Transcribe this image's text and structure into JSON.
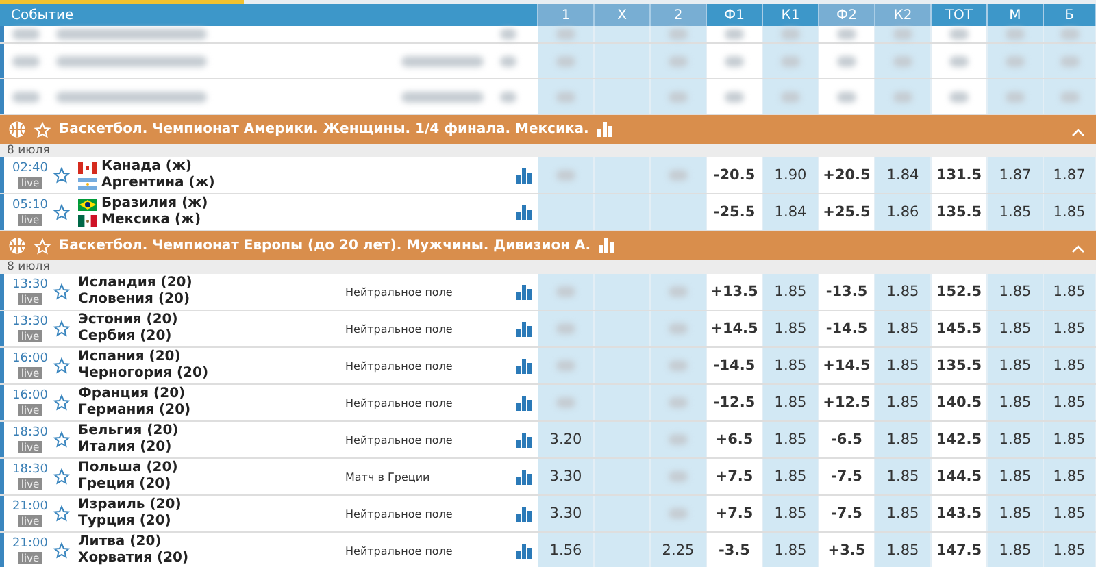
{
  "header": {
    "event_label": "Событие",
    "columns": [
      {
        "label": "1",
        "lit": false
      },
      {
        "label": "X",
        "lit": false
      },
      {
        "label": "2",
        "lit": false
      },
      {
        "label": "Ф1",
        "lit": true
      },
      {
        "label": "К1",
        "lit": true
      },
      {
        "label": "Ф2",
        "lit": false
      },
      {
        "label": "К2",
        "lit": false
      },
      {
        "label": "ТОТ",
        "lit": true
      },
      {
        "label": "М",
        "lit": true
      },
      {
        "label": "Б",
        "lit": true
      }
    ]
  },
  "blurred_rows": [
    {
      "kind": "partial"
    },
    {
      "kind": "full"
    },
    {
      "kind": "full"
    }
  ],
  "sections": [
    {
      "title": "Баскетбол. Чемпионат Америки. Женщины. 1/4 финала. Мексика.",
      "expanded": true,
      "date": "8 июля",
      "matches": [
        {
          "time": "02:40",
          "live": "live",
          "teams": [
            {
              "name": "Канада (ж)",
              "kind": "ca"
            },
            {
              "name": "Аргентина (ж)",
              "kind": "ar"
            }
          ],
          "odds": [
            {
              "kind": "blurred"
            },
            {
              "kind": "empty"
            },
            {
              "kind": "blurred"
            },
            {
              "kind": "value",
              "text": "-20.5"
            },
            {
              "kind": "value",
              "text": "1.90"
            },
            {
              "kind": "value",
              "text": "+20.5"
            },
            {
              "kind": "value",
              "text": "1.84"
            },
            {
              "kind": "value",
              "text": "131.5"
            },
            {
              "kind": "value",
              "text": "1.87"
            },
            {
              "kind": "value",
              "text": "1.87"
            }
          ]
        },
        {
          "time": "05:10",
          "live": "live",
          "teams": [
            {
              "name": "Бразилия (ж)",
              "kind": "br"
            },
            {
              "name": "Мексика (ж)",
              "kind": "mx"
            }
          ],
          "odds": [
            {
              "kind": "empty"
            },
            {
              "kind": "empty"
            },
            {
              "kind": "empty"
            },
            {
              "kind": "value",
              "text": "-25.5"
            },
            {
              "kind": "value",
              "text": "1.84"
            },
            {
              "kind": "value",
              "text": "+25.5"
            },
            {
              "kind": "value",
              "text": "1.86"
            },
            {
              "kind": "value",
              "text": "135.5"
            },
            {
              "kind": "value",
              "text": "1.85"
            },
            {
              "kind": "value",
              "text": "1.85"
            }
          ]
        }
      ]
    },
    {
      "title": "Баскетбол. Чемпионат Европы (до 20 лет). Мужчины. Дивизион А.",
      "expanded": true,
      "date": "8 июля",
      "matches": [
        {
          "time": "13:30",
          "live": "live",
          "teams": [
            {
              "name": "Исландия (20)"
            },
            {
              "name": "Словения (20)"
            }
          ],
          "note": "Нейтральное поле",
          "odds": [
            {
              "kind": "blurred"
            },
            {
              "kind": "empty"
            },
            {
              "kind": "blurred"
            },
            {
              "kind": "value",
              "text": "+13.5"
            },
            {
              "kind": "value",
              "text": "1.85"
            },
            {
              "kind": "value",
              "text": "-13.5"
            },
            {
              "kind": "value",
              "text": "1.85"
            },
            {
              "kind": "value",
              "text": "152.5"
            },
            {
              "kind": "value",
              "text": "1.85"
            },
            {
              "kind": "value",
              "text": "1.85"
            }
          ]
        },
        {
          "time": "13:30",
          "live": "live",
          "teams": [
            {
              "name": "Эстония (20)"
            },
            {
              "name": "Сербия (20)"
            }
          ],
          "note": "Нейтральное поле",
          "odds": [
            {
              "kind": "blurred"
            },
            {
              "kind": "empty"
            },
            {
              "kind": "blurred"
            },
            {
              "kind": "value",
              "text": "+14.5"
            },
            {
              "kind": "value",
              "text": "1.85"
            },
            {
              "kind": "value",
              "text": "-14.5"
            },
            {
              "kind": "value",
              "text": "1.85"
            },
            {
              "kind": "value",
              "text": "145.5"
            },
            {
              "kind": "value",
              "text": "1.85"
            },
            {
              "kind": "value",
              "text": "1.85"
            }
          ]
        },
        {
          "time": "16:00",
          "live": "live",
          "teams": [
            {
              "name": "Испания (20)"
            },
            {
              "name": "Черногория (20)"
            }
          ],
          "note": "Нейтральное поле",
          "odds": [
            {
              "kind": "blurred"
            },
            {
              "kind": "empty"
            },
            {
              "kind": "blurred"
            },
            {
              "kind": "value",
              "text": "-14.5"
            },
            {
              "kind": "value",
              "text": "1.85"
            },
            {
              "kind": "value",
              "text": "+14.5"
            },
            {
              "kind": "value",
              "text": "1.85"
            },
            {
              "kind": "value",
              "text": "135.5"
            },
            {
              "kind": "value",
              "text": "1.85"
            },
            {
              "kind": "value",
              "text": "1.85"
            }
          ]
        },
        {
          "time": "16:00",
          "live": "live",
          "teams": [
            {
              "name": "Франция (20)"
            },
            {
              "name": "Германия (20)"
            }
          ],
          "note": "Нейтральное поле",
          "odds": [
            {
              "kind": "blurred"
            },
            {
              "kind": "empty"
            },
            {
              "kind": "blurred"
            },
            {
              "kind": "value",
              "text": "-12.5"
            },
            {
              "kind": "value",
              "text": "1.85"
            },
            {
              "kind": "value",
              "text": "+12.5"
            },
            {
              "kind": "value",
              "text": "1.85"
            },
            {
              "kind": "value",
              "text": "140.5"
            },
            {
              "kind": "value",
              "text": "1.85"
            },
            {
              "kind": "value",
              "text": "1.85"
            }
          ]
        },
        {
          "time": "18:30",
          "live": "live",
          "teams": [
            {
              "name": "Бельгия (20)"
            },
            {
              "name": "Италия (20)"
            }
          ],
          "note": "Нейтральное поле",
          "odds": [
            {
              "kind": "value",
              "text": "3.20"
            },
            {
              "kind": "empty"
            },
            {
              "kind": "blurred"
            },
            {
              "kind": "value",
              "text": "+6.5"
            },
            {
              "kind": "value",
              "text": "1.85"
            },
            {
              "kind": "value",
              "text": "-6.5"
            },
            {
              "kind": "value",
              "text": "1.85"
            },
            {
              "kind": "value",
              "text": "142.5"
            },
            {
              "kind": "value",
              "text": "1.85"
            },
            {
              "kind": "value",
              "text": "1.85"
            }
          ]
        },
        {
          "time": "18:30",
          "live": "live",
          "teams": [
            {
              "name": "Польша (20)"
            },
            {
              "name": "Греция (20)"
            }
          ],
          "note": "Матч в Греции",
          "odds": [
            {
              "kind": "value",
              "text": "3.30"
            },
            {
              "kind": "empty"
            },
            {
              "kind": "blurred"
            },
            {
              "kind": "value",
              "text": "+7.5"
            },
            {
              "kind": "value",
              "text": "1.85"
            },
            {
              "kind": "value",
              "text": "-7.5"
            },
            {
              "kind": "value",
              "text": "1.85"
            },
            {
              "kind": "value",
              "text": "144.5"
            },
            {
              "kind": "value",
              "text": "1.85"
            },
            {
              "kind": "value",
              "text": "1.85"
            }
          ]
        },
        {
          "time": "21:00",
          "live": "live",
          "teams": [
            {
              "name": "Израиль (20)"
            },
            {
              "name": "Турция (20)"
            }
          ],
          "note": "Нейтральное поле",
          "odds": [
            {
              "kind": "value",
              "text": "3.30"
            },
            {
              "kind": "empty"
            },
            {
              "kind": "blurred"
            },
            {
              "kind": "value",
              "text": "+7.5"
            },
            {
              "kind": "value",
              "text": "1.85"
            },
            {
              "kind": "value",
              "text": "-7.5"
            },
            {
              "kind": "value",
              "text": "1.85"
            },
            {
              "kind": "value",
              "text": "143.5"
            },
            {
              "kind": "value",
              "text": "1.85"
            },
            {
              "kind": "value",
              "text": "1.85"
            }
          ]
        },
        {
          "time": "21:00",
          "live": "live",
          "teams": [
            {
              "name": "Литва (20)"
            },
            {
              "name": "Хорватия (20)"
            }
          ],
          "note": "Нейтральное поле",
          "odds": [
            {
              "kind": "value",
              "text": "1.56"
            },
            {
              "kind": "empty"
            },
            {
              "kind": "value",
              "text": "2.25"
            },
            {
              "kind": "value",
              "text": "-3.5"
            },
            {
              "kind": "value",
              "text": "1.85"
            },
            {
              "kind": "value",
              "text": "+3.5"
            },
            {
              "kind": "value",
              "text": "1.85"
            },
            {
              "kind": "value",
              "text": "147.5"
            },
            {
              "kind": "value",
              "text": "1.85"
            },
            {
              "kind": "value",
              "text": "1.85"
            }
          ]
        }
      ]
    }
  ]
}
